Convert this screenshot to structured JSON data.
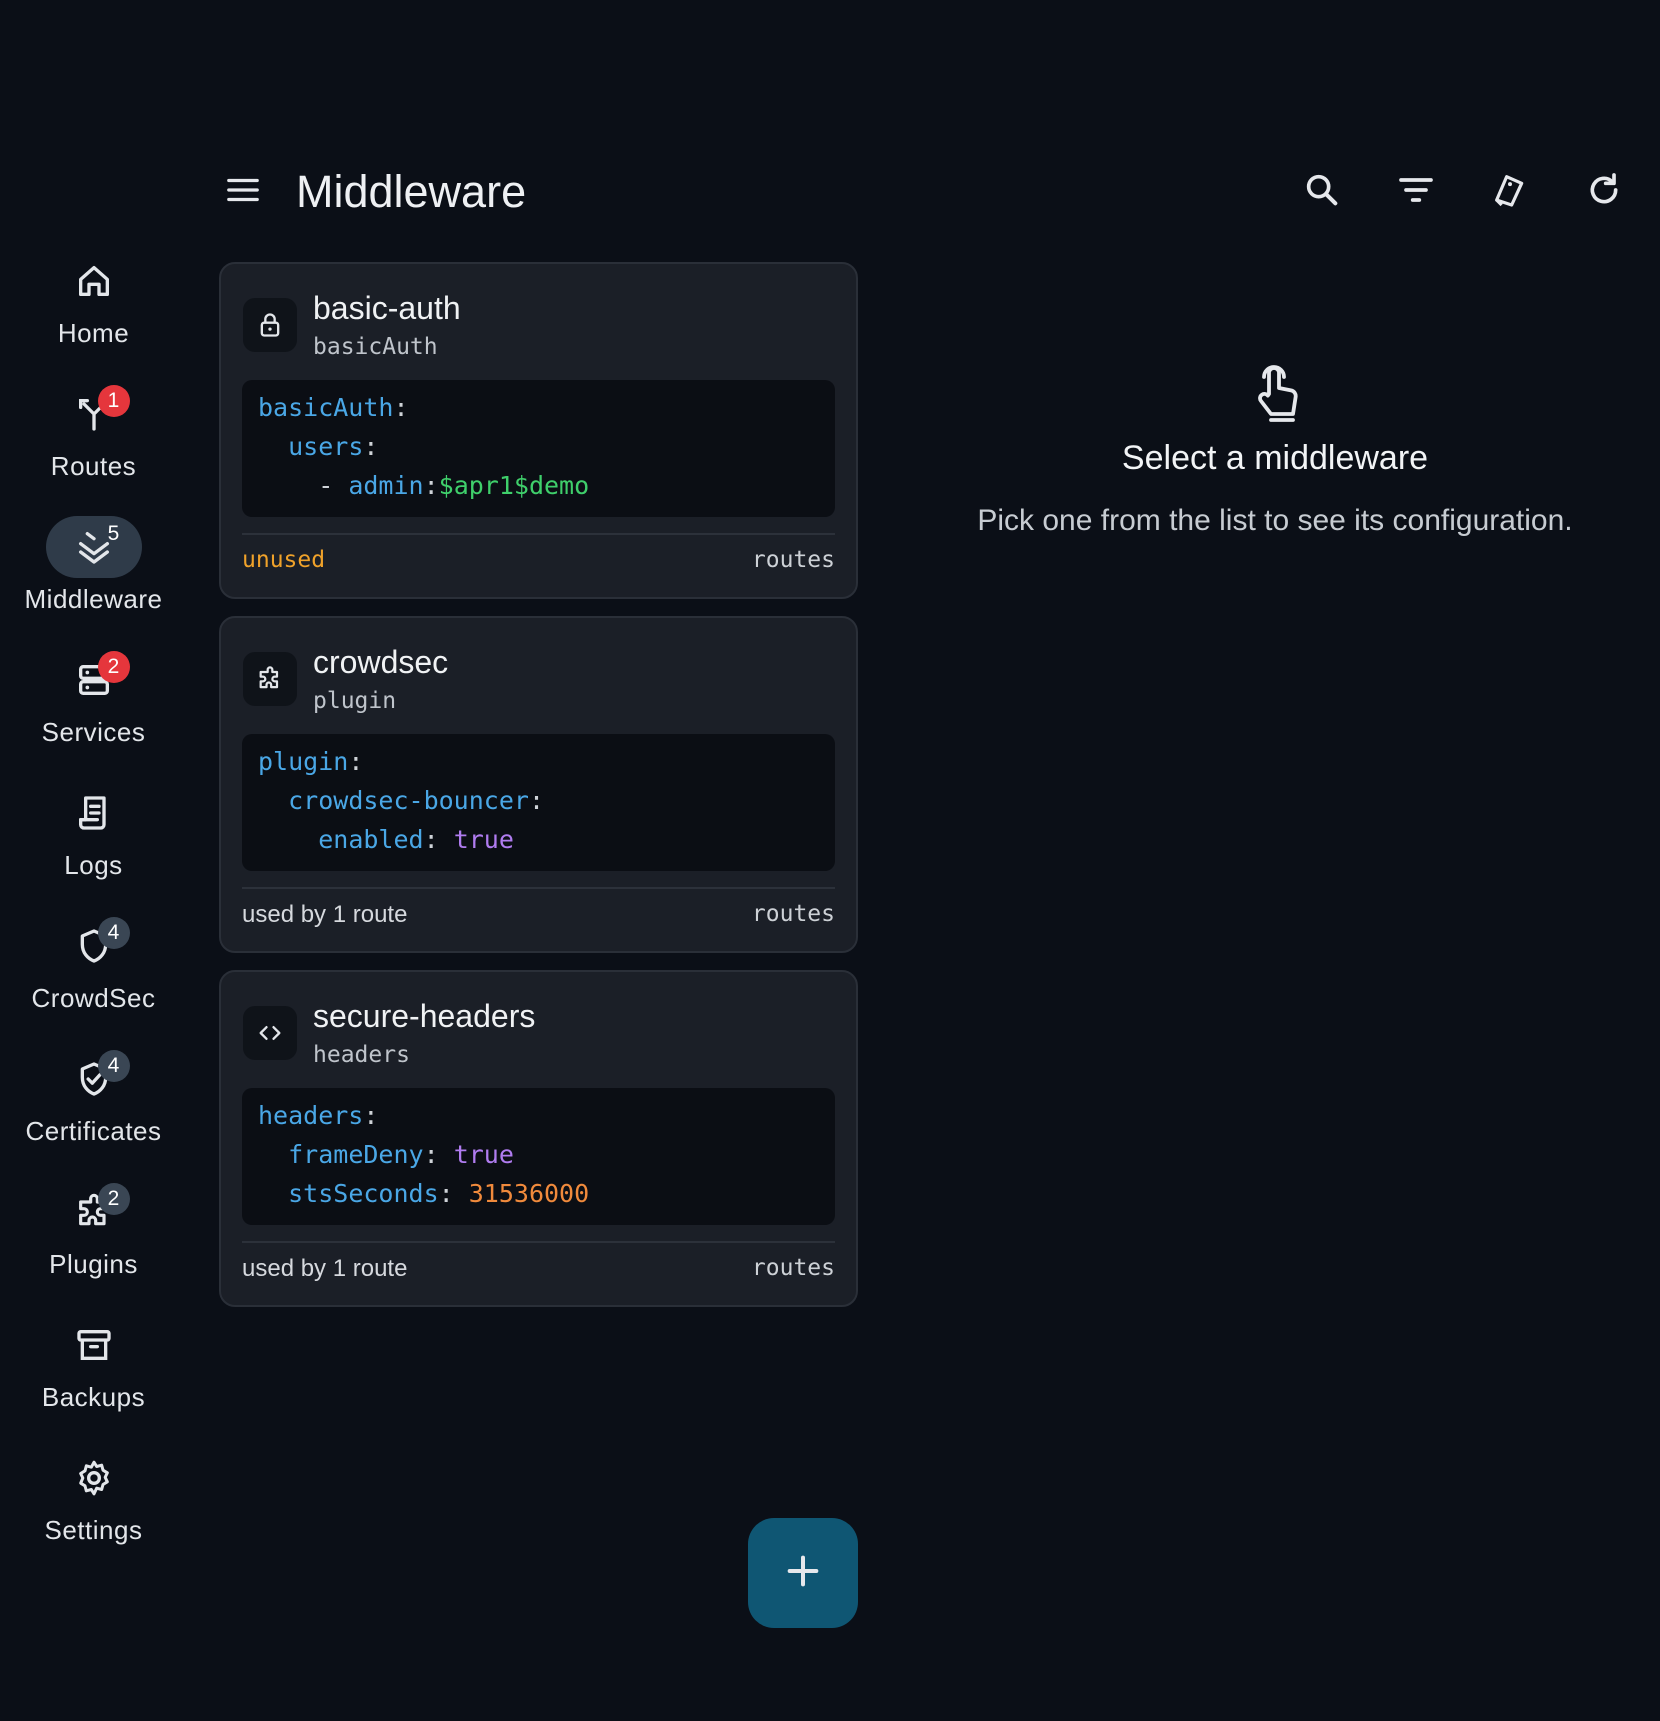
{
  "page": {
    "title": "Middleware"
  },
  "top_actions": [
    {
      "icon": "search-icon"
    },
    {
      "icon": "filter-icon"
    },
    {
      "icon": "tag-icon"
    },
    {
      "icon": "refresh-icon"
    }
  ],
  "rail": {
    "items": [
      {
        "label": "Home",
        "icon": "home-icon",
        "badge": ""
      },
      {
        "label": "Routes",
        "icon": "routes-icon",
        "badge": "1",
        "badge_style": "red"
      },
      {
        "label": "Middleware",
        "icon": "layers-icon",
        "badge": "5",
        "badge_style": "plain",
        "active": true
      },
      {
        "label": "Services",
        "icon": "server-icon",
        "badge": "2",
        "badge_style": "red"
      },
      {
        "label": "Logs",
        "icon": "logs-icon",
        "badge": ""
      },
      {
        "label": "CrowdSec",
        "icon": "shield-icon",
        "badge": "4",
        "badge_style": "grey"
      },
      {
        "label": "Certificates",
        "icon": "certificate-icon",
        "badge": "4",
        "badge_style": "grey"
      },
      {
        "label": "Plugins",
        "icon": "puzzle-icon",
        "badge": "2",
        "badge_style": "grey"
      },
      {
        "label": "Backups",
        "icon": "archive-icon",
        "badge": ""
      },
      {
        "label": "Settings",
        "icon": "gear-icon",
        "badge": ""
      }
    ]
  },
  "middlewares": [
    {
      "name": "basic-auth",
      "type": "basicAuth",
      "icon": "lock-icon",
      "code": [
        [
          {
            "t": "basicAuth",
            "c": "k"
          },
          {
            "t": ":",
            "c": "p"
          }
        ],
        [
          {
            "t": "  ",
            "c": "p"
          },
          {
            "t": "users",
            "c": "k"
          },
          {
            "t": ":",
            "c": "p"
          }
        ],
        [
          {
            "t": "    - ",
            "c": "p"
          },
          {
            "t": "admin",
            "c": "k"
          },
          {
            "t": ":",
            "c": "p"
          },
          {
            "t": "$apr1$demo",
            "c": "s"
          }
        ]
      ],
      "usage": "unused",
      "usage_unused": true,
      "link": "routes"
    },
    {
      "name": "crowdsec",
      "type": "plugin",
      "icon": "puzzle-icon",
      "code": [
        [
          {
            "t": "plugin",
            "c": "k"
          },
          {
            "t": ":",
            "c": "p"
          }
        ],
        [
          {
            "t": "  ",
            "c": "p"
          },
          {
            "t": "crowdsec-bouncer",
            "c": "k"
          },
          {
            "t": ":",
            "c": "p"
          }
        ],
        [
          {
            "t": "    ",
            "c": "p"
          },
          {
            "t": "enabled",
            "c": "k"
          },
          {
            "t": ": ",
            "c": "p"
          },
          {
            "t": "true",
            "c": "b"
          }
        ]
      ],
      "usage": "used by 1 route",
      "usage_unused": false,
      "link": "routes"
    },
    {
      "name": "secure-headers",
      "type": "headers",
      "icon": "code-icon",
      "code": [
        [
          {
            "t": "headers",
            "c": "k"
          },
          {
            "t": ":",
            "c": "p"
          }
        ],
        [
          {
            "t": "  ",
            "c": "p"
          },
          {
            "t": "frameDeny",
            "c": "k"
          },
          {
            "t": ": ",
            "c": "p"
          },
          {
            "t": "true",
            "c": "b"
          }
        ],
        [
          {
            "t": "  ",
            "c": "p"
          },
          {
            "t": "stsSeconds",
            "c": "k"
          },
          {
            "t": ": ",
            "c": "p"
          },
          {
            "t": "31536000",
            "c": "n"
          }
        ]
      ],
      "usage": "used by 1 route",
      "usage_unused": false,
      "link": "routes"
    }
  ],
  "empty_state": {
    "icon": "tap-icon",
    "title": "Select a middleware",
    "subtitle": "Pick one from the list to see its configuration."
  },
  "fab": {
    "icon": "plus-icon"
  },
  "colors": {
    "background": "#0b0f17",
    "card": "#1b1f27",
    "accent": "#0f5673",
    "badge_red": "#e5363c",
    "unused": "#f0a22a"
  }
}
